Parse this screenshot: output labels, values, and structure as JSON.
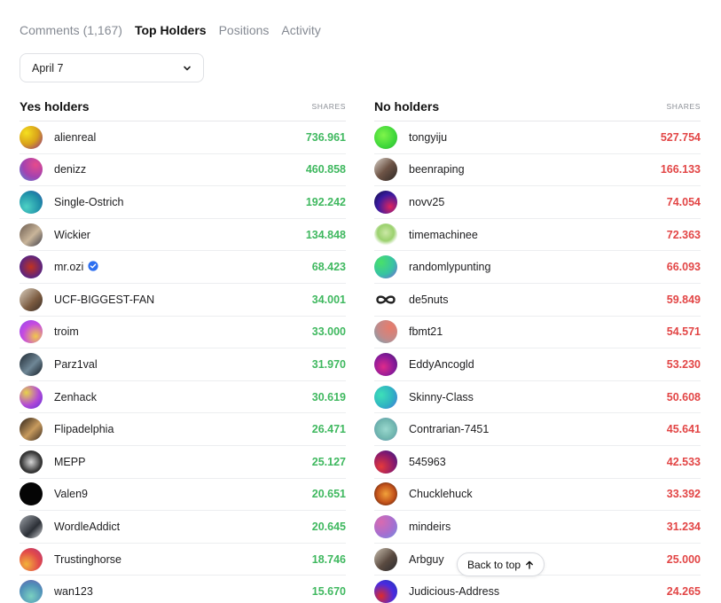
{
  "tabs": [
    {
      "label": "Comments (1,167)",
      "active": false
    },
    {
      "label": "Top Holders",
      "active": true
    },
    {
      "label": "Positions",
      "active": false
    },
    {
      "label": "Activity",
      "active": false
    }
  ],
  "date_filter": {
    "selected": "April 7"
  },
  "yes": {
    "title": "Yes holders",
    "shares_label": "SHARES",
    "rows": [
      {
        "name": "alienreal",
        "shares": "736.961",
        "avatar": "radial-gradient(circle at 30% 30%, #f5e020, #d9a21a 50%, #8c2a8e)"
      },
      {
        "name": "denizz",
        "shares": "460.858",
        "avatar": "radial-gradient(circle at 70% 30%, #e64b8b, #a342b0 55%, #4e8bd8)"
      },
      {
        "name": "Single-Ostrich",
        "shares": "192.242",
        "avatar": "radial-gradient(circle at 30% 70%, #4dd1c4, #1f8fa8 60%, #2b4fa6)"
      },
      {
        "name": "Wickier",
        "shares": "134.848",
        "avatar": "linear-gradient(135deg, #6a5a4e, #c9b59a 55%, #3b3b46)"
      },
      {
        "name": "mr.ozi",
        "shares": "68.423",
        "avatar": "radial-gradient(circle at 50% 50%, #c2321f, #5a2480 70%)",
        "verified": true
      },
      {
        "name": "UCF-BIGGEST-FAN",
        "shares": "34.001",
        "avatar": "linear-gradient(135deg, #d9cfc0, #7a5a3f 60%, #3a2e28)"
      },
      {
        "name": "troim",
        "shares": "33.000",
        "avatar": "radial-gradient(circle at 70% 70%, #f1c84a, #c64be0 55%, #8c49f0)"
      },
      {
        "name": "Parz1val",
        "shares": "31.970",
        "avatar": "linear-gradient(135deg, #1c2630, #6f8796 55%, #101820)"
      },
      {
        "name": "Zenhack",
        "shares": "30.619",
        "avatar": "radial-gradient(circle at 30% 30%, #e7d34a, #b24ad6 55%, #5b2dd8)"
      },
      {
        "name": "Flipadelphia",
        "shares": "26.471",
        "avatar": "linear-gradient(135deg, #2a1f18, #c79a5d 55%, #3b2c21)"
      },
      {
        "name": "MEPP",
        "shares": "25.127",
        "avatar": "radial-gradient(circle at 50% 50%, #d8d8d8, #3a3a3a 60%, #111)"
      },
      {
        "name": "Valen9",
        "shares": "20.651",
        "avatar": "#050505"
      },
      {
        "name": "WordleAddict",
        "shares": "20.645",
        "avatar": "linear-gradient(135deg, #9fa4aa, #2b2f36 60%, #d6d8db)"
      },
      {
        "name": "Trustinghorse",
        "shares": "18.746",
        "avatar": "radial-gradient(circle at 30% 70%, #f2b33a, #e24a4a 55%, #b3347a)"
      },
      {
        "name": "wan123",
        "shares": "15.670",
        "avatar": "radial-gradient(circle at 50% 70%, #7ad1c0, #4f8fb8 60%, #6f5fb0)"
      }
    ]
  },
  "no": {
    "title": "No holders",
    "shares_label": "SHARES",
    "rows": [
      {
        "name": "tongyiju",
        "shares": "527.754",
        "avatar": "radial-gradient(circle at 40% 40%, #7ff54a, #3ed63a 60%, #2fb036)"
      },
      {
        "name": "beenraping",
        "shares": "166.133",
        "avatar": "linear-gradient(135deg, #d9d2c9, #6e5446 50%, #2d2724)"
      },
      {
        "name": "novv25",
        "shares": "74.054",
        "avatar": "radial-gradient(circle at 70% 70%, #e0245e, #3a1aa0 55%, #0b0d3a)"
      },
      {
        "name": "timemachinee",
        "shares": "72.363",
        "avatar": "radial-gradient(circle at 50% 40%, #cbe8a6, #9bd16e 45%, #ffffff 70%)"
      },
      {
        "name": "randomlypunting",
        "shares": "66.093",
        "avatar": "radial-gradient(circle at 30% 30%, #49e06a, #37c2a4 55%, #7b5de0)"
      },
      {
        "name": "de5nuts",
        "shares": "59.849",
        "avatar": "infinity"
      },
      {
        "name": "fbmt21",
        "shares": "54.571",
        "avatar": "radial-gradient(circle at 70% 30%, #e97b6a, #c28a8a 55%, #6fa8b8)"
      },
      {
        "name": "EddyAncogld",
        "shares": "53.230",
        "avatar": "radial-gradient(circle at 40% 60%, #e02a8a, #8a1a9a 55%, #3a1a6a)"
      },
      {
        "name": "Skinny-Class",
        "shares": "50.608",
        "avatar": "radial-gradient(circle at 30% 40%, #3ee0b8, #2fb3c2 55%, #4b6fe0)"
      },
      {
        "name": "Contrarian-7451",
        "shares": "45.641",
        "avatar": "radial-gradient(circle at 50% 50%, #9ad8cf, #72b8b0 55%, #5e8fb0)"
      },
      {
        "name": "545963",
        "shares": "42.533",
        "avatar": "radial-gradient(circle at 30% 70%, #e6393a, #8e1a6a 55%, #2b1a8a)"
      },
      {
        "name": "Chucklehuck",
        "shares": "33.392",
        "avatar": "radial-gradient(circle at 50% 50%, #f2a23a, #c2511a 55%, #2a140a)"
      },
      {
        "name": "mindeirs",
        "shares": "31.234",
        "avatar": "radial-gradient(circle at 30% 30%, #d86ab0, #a66fd0 55%, #6f8fe0)"
      },
      {
        "name": "Arbguy",
        "shares": "25.000",
        "avatar": "linear-gradient(135deg, #c9c0b0, #5a4a40 55%, #2b2a2e)"
      },
      {
        "name": "Judicious-Address",
        "shares": "24.265",
        "avatar": "radial-gradient(circle at 30% 70%, #e02a2a, #4a2ae0 55%, #1a3ab0)"
      }
    ]
  },
  "back_to_top": {
    "label": "Back to top"
  }
}
